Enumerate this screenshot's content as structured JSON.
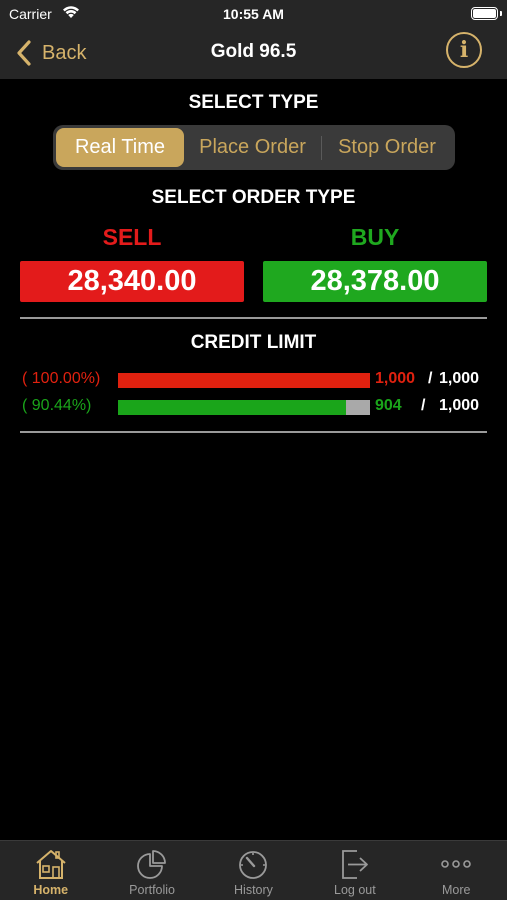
{
  "status_bar": {
    "carrier": "Carrier",
    "time": "10:55 AM"
  },
  "nav": {
    "back_label": "Back",
    "title": "Gold 96.5",
    "info_symbol": "i"
  },
  "select_type": {
    "heading": "SELECT TYPE",
    "segments": [
      {
        "label": "Real Time",
        "selected": true
      },
      {
        "label": "Place Order",
        "selected": false
      },
      {
        "label": "Stop Order",
        "selected": false
      }
    ]
  },
  "order_type": {
    "heading": "SELECT ORDER TYPE",
    "sell": {
      "label": "SELL",
      "price": "28,340.00"
    },
    "buy": {
      "label": "BUY",
      "price": "28,378.00"
    }
  },
  "credit_limit": {
    "heading": "CREDIT LIMIT",
    "rows": [
      {
        "percent": "( 100.00%)",
        "used": "1,000",
        "slash": "/",
        "total": "1,000",
        "fill": 1.0
      },
      {
        "percent": "( 90.44%)",
        "used": "904",
        "slash": "/",
        "total": "1,000",
        "fill": 0.9044
      }
    ]
  },
  "tab_bar": {
    "tabs": [
      {
        "label": "Home",
        "icon": "home-icon",
        "active": true
      },
      {
        "label": "Portfolio",
        "icon": "pie-chart-icon",
        "active": false
      },
      {
        "label": "History",
        "icon": "gauge-icon",
        "active": false
      },
      {
        "label": "Log out",
        "icon": "logout-icon",
        "active": false
      },
      {
        "label": "More",
        "icon": "more-icon",
        "active": false
      }
    ]
  },
  "colors": {
    "gold": "#c9a65c",
    "sell_red": "#e31b1b",
    "buy_green": "#1fa81f",
    "bar_red": "#e0210f",
    "bar_green": "#1aa51a"
  }
}
